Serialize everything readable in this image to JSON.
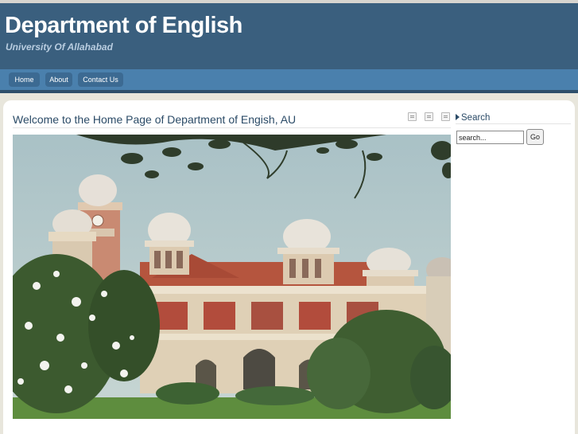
{
  "header": {
    "title": "Department of English",
    "subtitle": "University Of Allahabad"
  },
  "nav": {
    "items": [
      {
        "label": "Home"
      },
      {
        "label": "About"
      },
      {
        "label": "Contact Us"
      }
    ]
  },
  "main": {
    "heading": "Welcome to the Home Page of Department of Engish, AU",
    "toolbar_icons": [
      "pdf-icon",
      "print-icon",
      "email-icon"
    ],
    "image": "university-building-photo"
  },
  "search": {
    "heading": "Search",
    "placeholder": "search...",
    "button_label": "Go"
  },
  "colors": {
    "header_bg": "#3a5f7e",
    "nav_bg": "#4a80ad",
    "heading_text": "#2b4b67",
    "page_bg": "#e8e6dc"
  }
}
